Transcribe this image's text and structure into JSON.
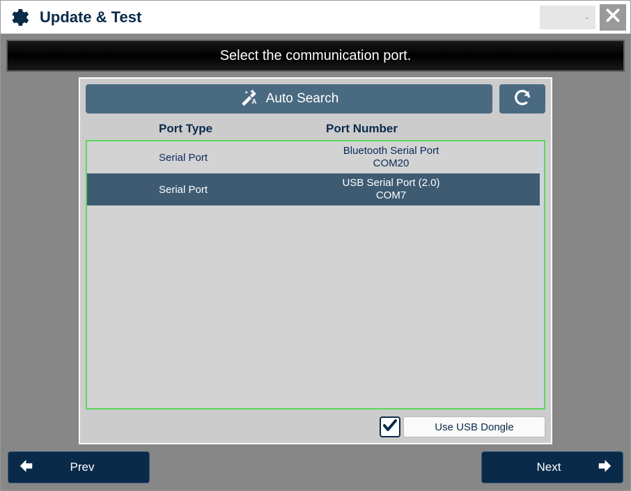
{
  "titlebar": {
    "title": "Update & Test",
    "lang_indicator": "-"
  },
  "banner": "Select the communication port.",
  "panel": {
    "auto_search_label": "Auto Search",
    "col_type": "Port Type",
    "col_number": "Port Number",
    "rows": [
      {
        "type": "Serial Port",
        "name": "Bluetooth Serial Port",
        "com": "COM20",
        "selected": false
      },
      {
        "type": "Serial Port",
        "name": "USB Serial Port (2.0)",
        "com": "COM7",
        "selected": true
      }
    ],
    "dongle": {
      "checked": true,
      "label": "Use USB Dongle"
    }
  },
  "nav": {
    "prev": "Prev",
    "next": "Next"
  },
  "colors": {
    "accent": "#4a6a82",
    "dark": "#0a2a4a",
    "highlight_border": "#5bd65b"
  }
}
